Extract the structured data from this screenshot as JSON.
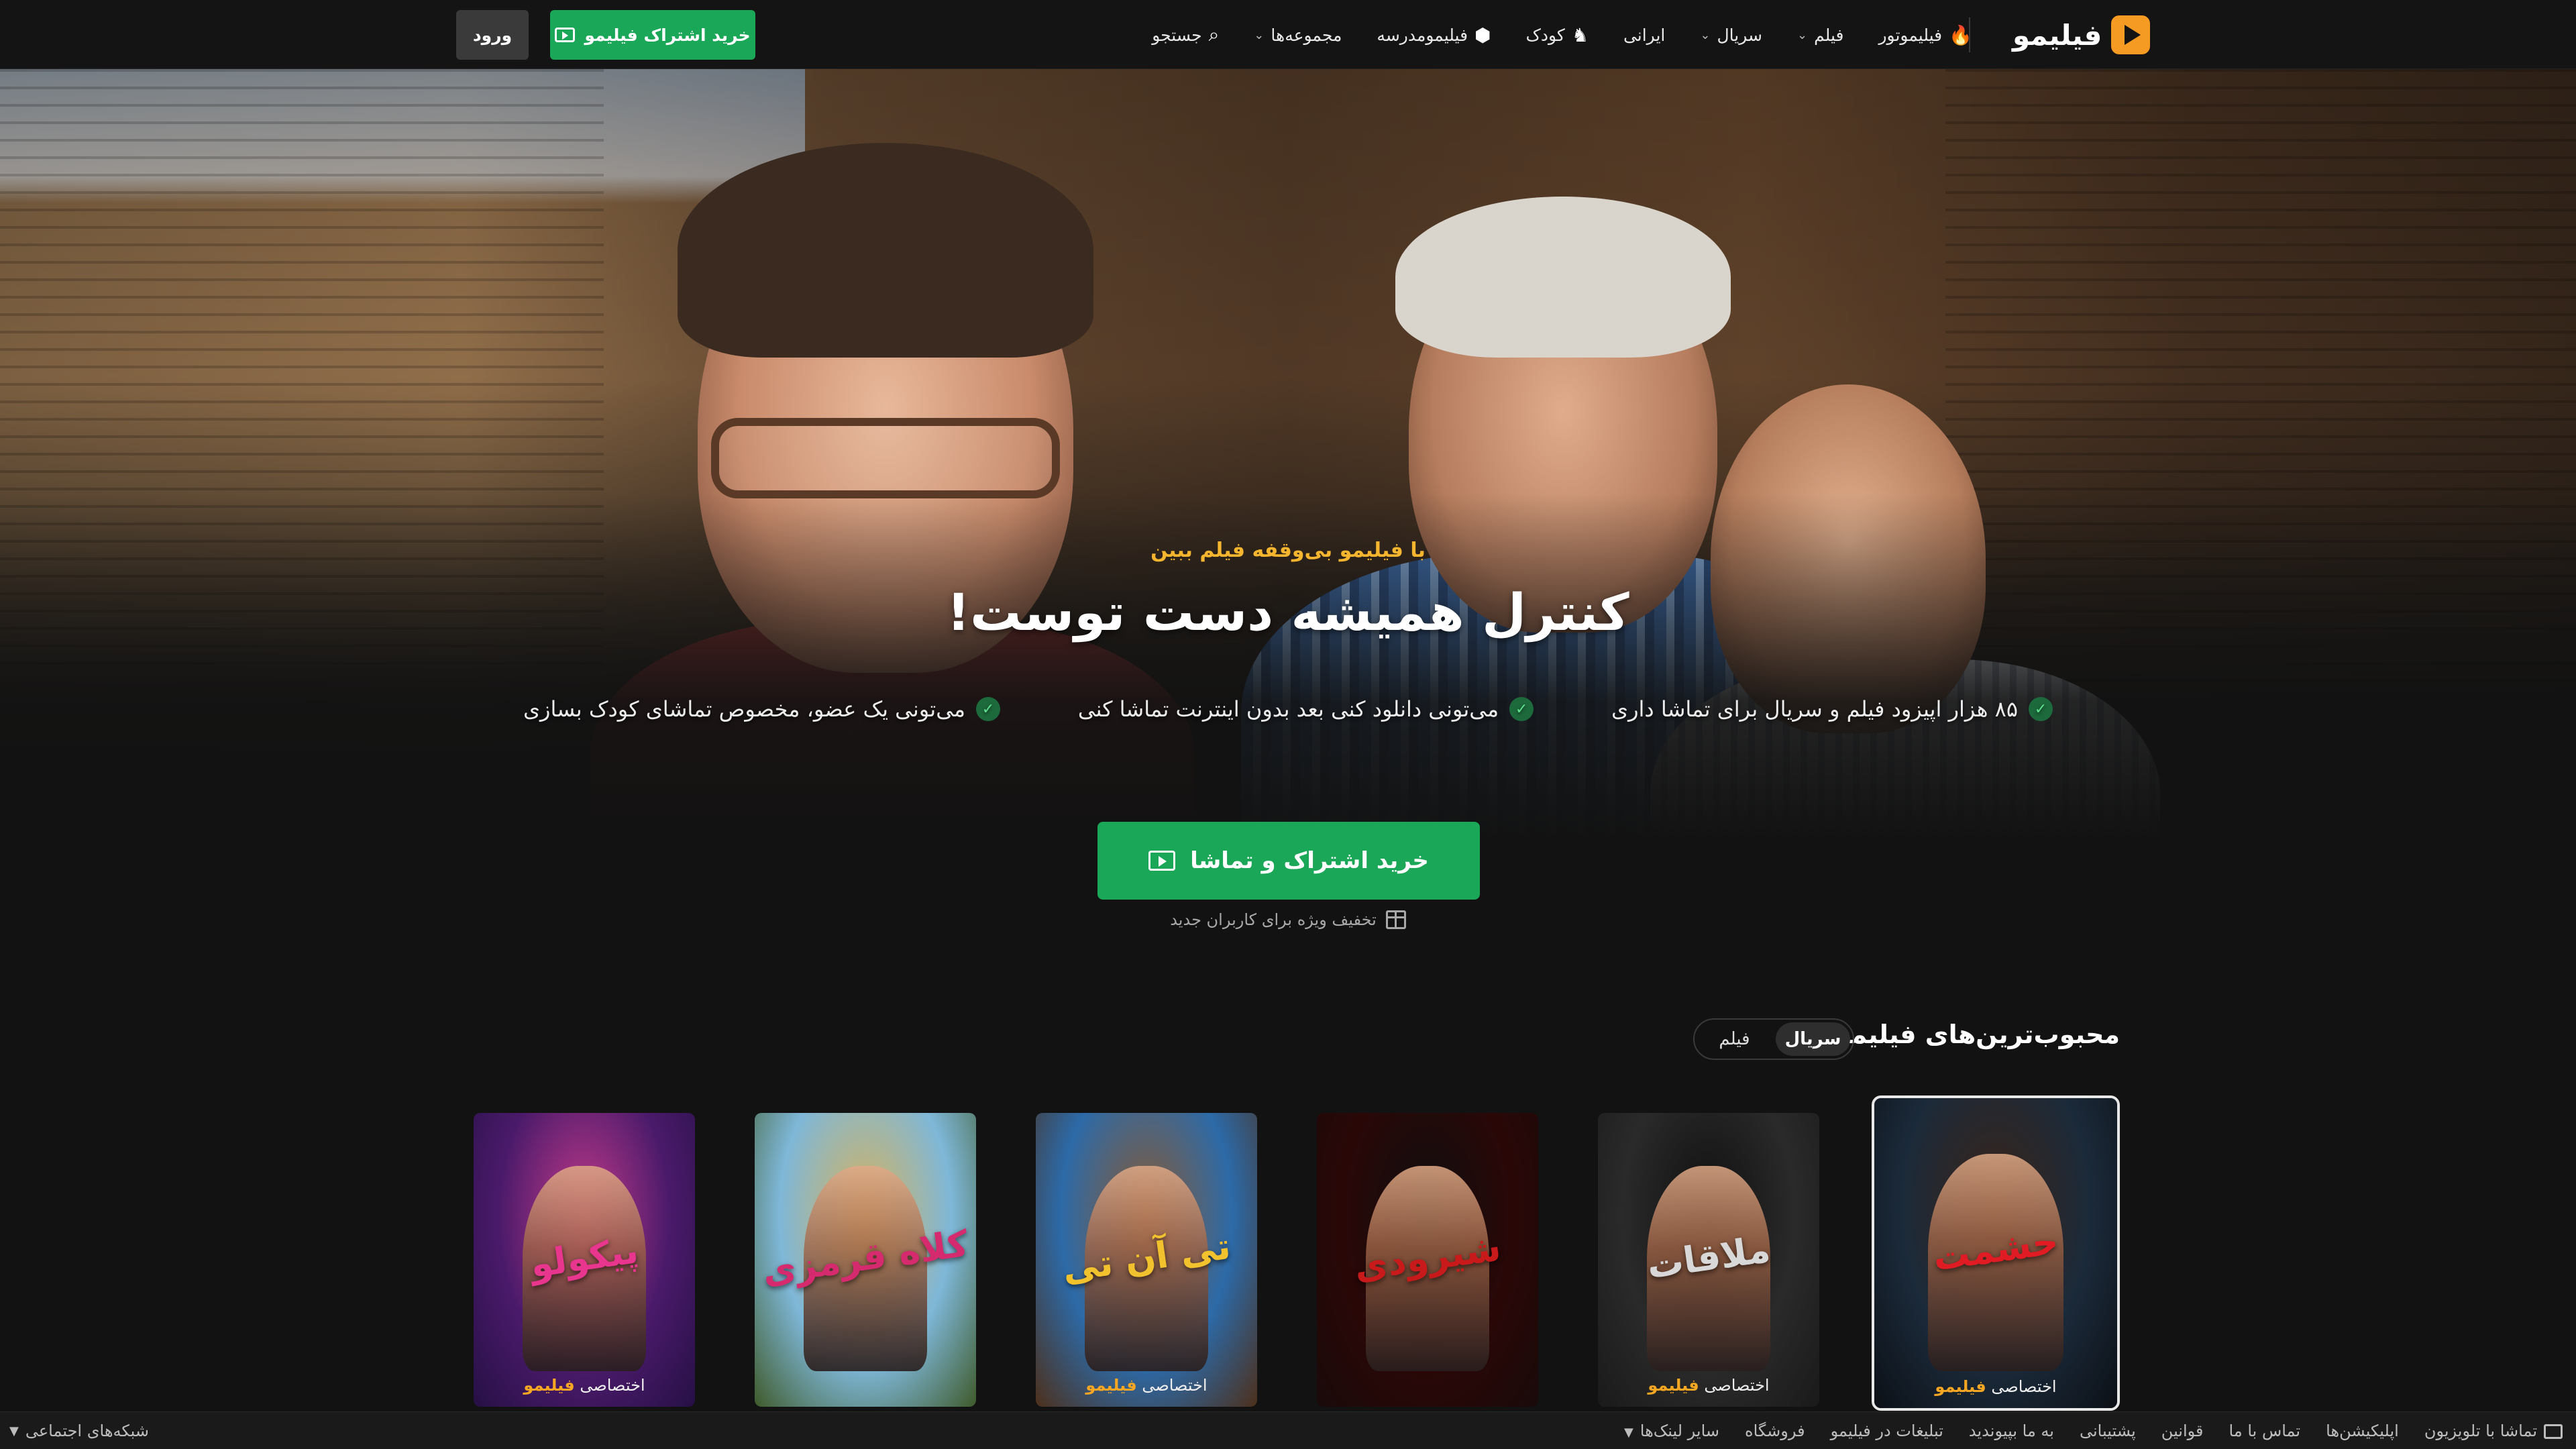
{
  "header": {
    "logo_text": "فیلیمو",
    "nav": [
      {
        "label": "فیلیموتور",
        "icon": "fire-icon",
        "dropdown": false
      },
      {
        "label": "فیلم",
        "icon": "",
        "dropdown": true
      },
      {
        "label": "سریال",
        "icon": "",
        "dropdown": true
      },
      {
        "label": "ایرانی",
        "icon": "",
        "dropdown": false
      },
      {
        "label": "کودک",
        "icon": "rocking-horse-icon",
        "dropdown": false
      },
      {
        "label": "فیلیمومدرسه",
        "icon": "school-icon",
        "dropdown": false
      },
      {
        "label": "مجموعه‌ها",
        "icon": "",
        "dropdown": true
      },
      {
        "label": "جستجو",
        "icon": "search-icon",
        "dropdown": false
      }
    ],
    "subscribe_label": "خرید اشتراک فیلیمو",
    "login_label": "ورود"
  },
  "hero": {
    "tagline": "با فیلیمو بی‌وقفه فیلم ببین",
    "title": "کنترل همیشه دست توست!",
    "features": [
      "۸۵ هزار اپیزود فیلم و سریال برای تماشا داری",
      "می‌تونی دانلود کنی بعد بدون اینترنت تماشا کنی",
      "می‌تونی یک عضو، مخصوص تماشای کودک بسازی"
    ],
    "cta_label": "خرید اشتراک و تماشا",
    "discount_note": "تخفیف ویژه برای کاربران جدید"
  },
  "popular": {
    "title": "محبوب‌ترین‌های فیلیمو",
    "tabs": [
      "سریال",
      "فیلم"
    ],
    "active_tab": "سریال",
    "exclusive_prefix": "اختصاصی",
    "exclusive_brand": "فیلیمو",
    "cards": [
      {
        "title": "حشمت",
        "exclusive": true,
        "selected": true,
        "colors": [
          "#1b2a3a",
          "#3a2418",
          "#0c1016"
        ],
        "title_color": "#e01b24"
      },
      {
        "title": "ملاقات",
        "exclusive": true,
        "selected": false,
        "colors": [
          "#2a2a2a",
          "#0f0f0f",
          "#1a1a1a"
        ],
        "title_color": "#d8d8d8"
      },
      {
        "title": "شیرودی",
        "exclusive": false,
        "selected": false,
        "colors": [
          "#2a0707",
          "#0f0f10",
          "#1a0a0a"
        ],
        "title_color": "#c81a1a"
      },
      {
        "title": "تی آن تی",
        "exclusive": true,
        "selected": false,
        "colors": [
          "#2c6aa8",
          "#8a5a32",
          "#4d2f1a"
        ],
        "title_color": "#f2c12e"
      },
      {
        "title": "کلاه قرمزی",
        "exclusive": false,
        "selected": false,
        "colors": [
          "#7eb7d8",
          "#d7b35c",
          "#3f5a2a"
        ],
        "title_color": "#d62a6f"
      },
      {
        "title": "پیکولو",
        "exclusive": true,
        "selected": false,
        "colors": [
          "#4a1a6a",
          "#c43a8a",
          "#261045"
        ],
        "title_color": "#e8358e"
      }
    ]
  },
  "footer": {
    "links": [
      "تماشا با تلویزیون",
      "اپلیکیشن‌ها",
      "تماس با ما",
      "قوانین",
      "پشتیبانی",
      "به ما بپیوندید",
      "تبلیغات در فیلیمو",
      "فروشگاه",
      "سایر لینک‌ها"
    ],
    "social_label": "شبکه‌های اجتماعی"
  }
}
